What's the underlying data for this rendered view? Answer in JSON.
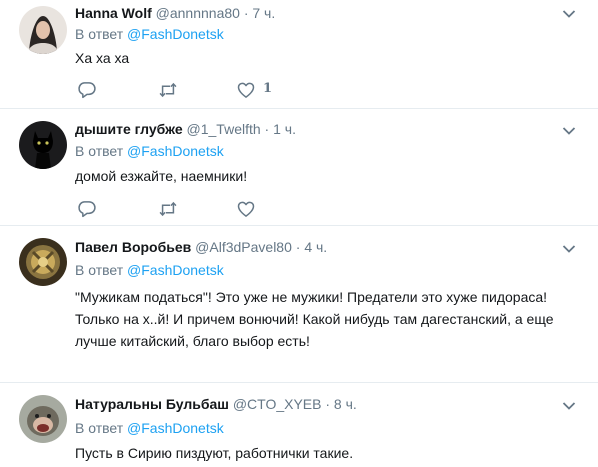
{
  "tweets": [
    {
      "name": "Hanna Wolf",
      "handle": "@annnnna80",
      "time": "· 7 ч.",
      "reply_prefix": "В ответ",
      "reply_to": "@FashDonetsk",
      "text": "Ха ха ха",
      "like_count": "1"
    },
    {
      "name": "дышите глубже",
      "handle": "@1_Twelfth",
      "time": "· 1 ч.",
      "reply_prefix": "В ответ",
      "reply_to": "@FashDonetsk",
      "text": "домой езжайте, наемники!"
    },
    {
      "name": "Павел Воробьев",
      "handle": "@Alf3dPavel80",
      "time": "· 4 ч.",
      "reply_prefix": "В ответ",
      "reply_to": "@FashDonetsk",
      "text_lines": [
        "\"Мужикам податься\"! Это уже не мужики! Предатели это хуже пидораса!",
        "Только на х..й! И причем вонючий! Какой нибудь там дагестанский, а еще",
        "лучше китайский, благо выбор есть!"
      ]
    },
    {
      "name": "Натуральны Бульбаш",
      "handle": "@CTO_XYEB",
      "time": "· 8 ч.",
      "reply_prefix": "В ответ",
      "reply_to": "@FashDonetsk",
      "text": "Пусть в Сирию пиздуют, работнички такие."
    }
  ],
  "colors": {
    "link": "#1da1f2",
    "secondary": "#657786",
    "separator": "#e6ecf0"
  },
  "icons": [
    "reply-icon",
    "retweet-icon",
    "like-icon",
    "chevron-down-icon"
  ]
}
